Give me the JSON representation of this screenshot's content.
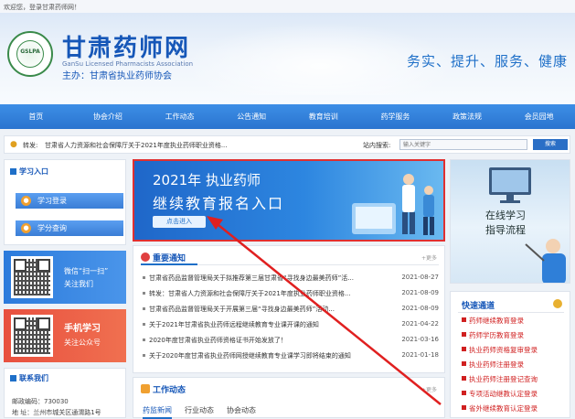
{
  "topbar": {
    "welcome": "欢迎您，登录甘肃药师网！"
  },
  "header": {
    "seal_text": "GSLPA",
    "title": "甘肃药师网",
    "subtitle_en": "GanSu Licensed Pharmacists Association",
    "org": "主办：甘肃省执业药师协会",
    "slogan": "务实、提升、服务、健康"
  },
  "nav": {
    "items": [
      "首页",
      "协会介绍",
      "工作动态",
      "公告通知",
      "教育培训",
      "药学服务",
      "政策法规",
      "会员园地"
    ]
  },
  "news_strip": {
    "label": "转发:",
    "headline": "甘肃省人力资源和社会保障厅关于2021年度执业药师职业资格...",
    "search_label": "站内搜索:",
    "search_placeholder": "输入关键字",
    "search_button": "搜索"
  },
  "learn": {
    "title": "学习入口",
    "login": "学习登录",
    "credits": "学分查询"
  },
  "banner": {
    "line1": "2021年 执业药师",
    "line2": "继续教育报名入口",
    "button": "点击进入"
  },
  "guide": {
    "line1": "在线学习",
    "line2": "指导流程"
  },
  "wechat": {
    "line1": "微信“扫一扫”",
    "line2": "关注我们"
  },
  "mobile": {
    "line1": "手机学习",
    "line2": "关注公众号"
  },
  "contact": {
    "title": "联系我们",
    "postcode": "邮政编码：730030",
    "address": "地 址：兰州市城关区通渭路1号"
  },
  "notices": {
    "title": "重要通知",
    "more": "+更多",
    "items": [
      {
        "title": "甘肃省药品监督管理局关于拟推荐第三届甘肃省“寻找身边最美药师”活...",
        "date": "2021-08-27"
      },
      {
        "title": "转发：甘肃省人力资源和社会保障厅关于2021年度执业药师职业资格...",
        "date": "2021-08-09"
      },
      {
        "title": "甘肃省药品监督管理局关于开展第三届“寻找身边最美药师”活动...",
        "date": "2021-08-09"
      },
      {
        "title": "关于2021年甘肃省执业药师远程继续教育专业课开课的通知",
        "date": "2021-04-22"
      },
      {
        "title": "2020年度甘肃省执业药师资格证书开始发放了！",
        "date": "2021-03-16"
      },
      {
        "title": "关于2020年度甘肃省执业药师网授继续教育专业课学习即将结束的通知",
        "date": "2021-01-18"
      }
    ]
  },
  "work": {
    "title": "工作动态",
    "more": "+更多",
    "tabs": [
      "药监新闻",
      "行业动态",
      "协会动态"
    ]
  },
  "quick": {
    "title": "快速通道",
    "items": [
      "药师继续教育登录",
      "药师学历教育登录",
      "执业药师资格复审登录",
      "执业药师注册登录",
      "执业药师注册登记查询",
      "专项活动继教认定登录",
      "省外继续教育认定登录"
    ]
  },
  "colors": {
    "brand_blue": "#1657b8",
    "nav_blue": "#2a74cf",
    "accent_red": "#e03030",
    "wechat_blue": "#2c7bdc",
    "mobile_red": "#e8503f"
  }
}
